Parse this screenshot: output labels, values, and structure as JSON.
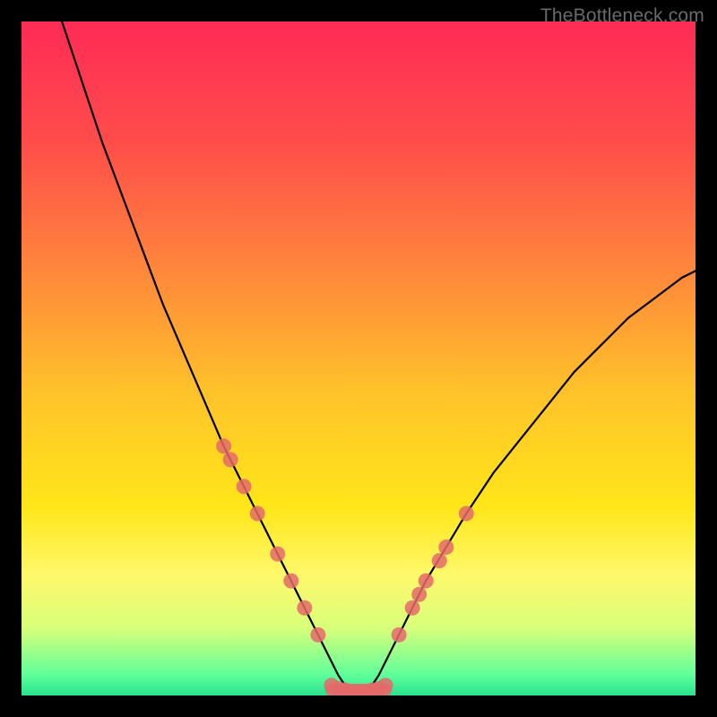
{
  "watermark": "TheBottleneck.com",
  "chart_data": {
    "type": "line",
    "title": "",
    "xlabel": "",
    "ylabel": "",
    "xlim": [
      0,
      100
    ],
    "ylim": [
      0,
      100
    ],
    "grid": false,
    "legend": false,
    "background_gradient": {
      "stops": [
        {
          "offset": 0.0,
          "color": "#ff2b56"
        },
        {
          "offset": 0.18,
          "color": "#ff4d4a"
        },
        {
          "offset": 0.38,
          "color": "#ff8a3a"
        },
        {
          "offset": 0.55,
          "color": "#ffc22a"
        },
        {
          "offset": 0.72,
          "color": "#ffe619"
        },
        {
          "offset": 0.82,
          "color": "#fff86a"
        },
        {
          "offset": 0.9,
          "color": "#d8ff7a"
        },
        {
          "offset": 0.97,
          "color": "#5eff9b"
        },
        {
          "offset": 1.0,
          "color": "#28e28e"
        }
      ]
    },
    "series": [
      {
        "name": "curve",
        "type": "line",
        "color": "#000000",
        "x": [
          6,
          8,
          10,
          12,
          15,
          18,
          21,
          24,
          27,
          30,
          33,
          36,
          38,
          40,
          42,
          44,
          46,
          47,
          48,
          49,
          50,
          51,
          52,
          53,
          54,
          56,
          58,
          60,
          63,
          66,
          70,
          74,
          78,
          82,
          86,
          90,
          94,
          98,
          100
        ],
        "y": [
          100,
          94,
          88,
          82,
          74,
          66,
          58,
          51,
          44,
          37,
          31,
          25,
          21,
          17,
          13,
          9,
          5,
          3,
          1.5,
          0.7,
          0.5,
          0.7,
          1.5,
          3,
          5,
          9,
          13,
          17,
          22,
          27,
          33,
          38,
          43,
          48,
          52,
          56,
          59,
          62,
          63
        ]
      },
      {
        "name": "markers-left",
        "type": "scatter",
        "color": "#e46a6a",
        "x": [
          30,
          31,
          33,
          35,
          38,
          40,
          42,
          44
        ],
        "y": [
          37,
          35,
          31,
          27,
          21,
          17,
          13,
          9
        ]
      },
      {
        "name": "markers-right",
        "type": "scatter",
        "color": "#e46a6a",
        "x": [
          56,
          58,
          59,
          60,
          62,
          63,
          66
        ],
        "y": [
          9,
          13,
          15,
          17,
          20,
          22,
          27
        ]
      },
      {
        "name": "markers-bottom",
        "type": "scatter",
        "color": "#e46a6a",
        "x": [
          46,
          47,
          48,
          49,
          50,
          51,
          52,
          53,
          54
        ],
        "y": [
          1.5,
          1,
          0.8,
          0.6,
          0.6,
          0.6,
          0.8,
          1,
          1.5
        ]
      }
    ]
  }
}
